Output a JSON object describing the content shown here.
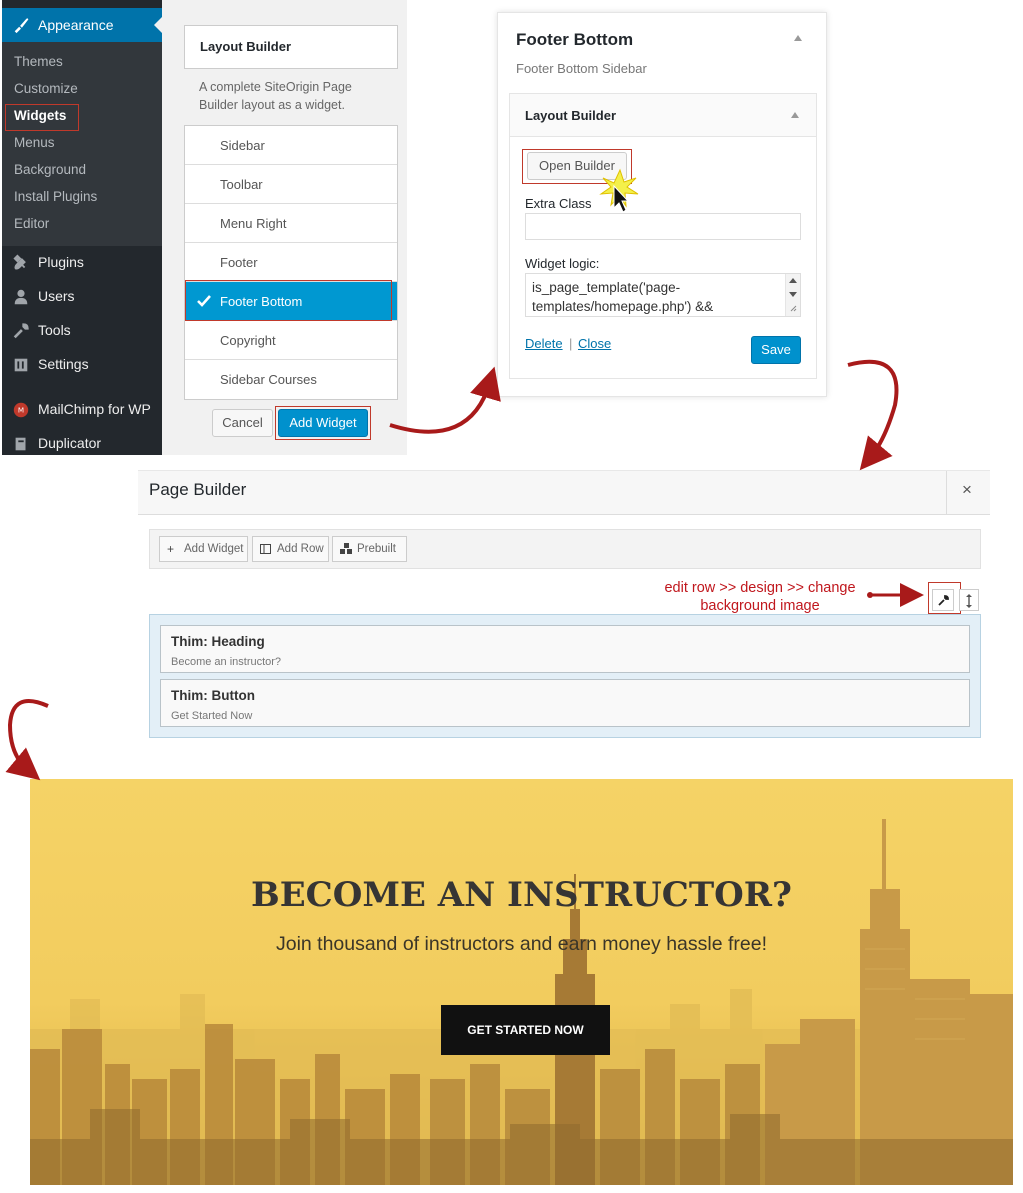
{
  "wp_menu": {
    "appearance": "Appearance",
    "submenu": [
      "Themes",
      "Customize",
      "Widgets",
      "Menus",
      "Background",
      "Install Plugins",
      "Editor"
    ],
    "current_submenu": "Widgets",
    "items": [
      {
        "label": "Plugins",
        "icon": "plugin-icon"
      },
      {
        "label": "Users",
        "icon": "users-icon"
      },
      {
        "label": "Tools",
        "icon": "wrench-icon"
      },
      {
        "label": "Settings",
        "icon": "settings-icon"
      },
      {
        "label": "MailChimp for WP",
        "icon": "mailchimp-icon"
      },
      {
        "label": "Duplicator",
        "icon": "duplicator-icon"
      }
    ]
  },
  "widget_chooser": {
    "widget_name": "Layout Builder",
    "description": "A complete SiteOrigin Page Builder layout as a widget.",
    "sidebars": [
      "Sidebar",
      "Toolbar",
      "Menu Right",
      "Footer",
      "Footer Bottom",
      "Copyright",
      "Sidebar Courses"
    ],
    "selected_sidebar": "Footer Bottom",
    "cancel_label": "Cancel",
    "add_label": "Add Widget"
  },
  "sidebar_panel": {
    "title": "Footer Bottom",
    "subtitle": "Footer Bottom Sidebar",
    "widget": {
      "title": "Layout Builder",
      "open_builder_label": "Open Builder",
      "extra_class_label": "Extra Class",
      "extra_class_value": "",
      "widget_logic_label": "Widget logic:",
      "widget_logic_value": "is_page_template('page-templates/homepage.php') &&",
      "delete_label": "Delete",
      "separator": "|",
      "close_label": "Close",
      "save_label": "Save"
    }
  },
  "page_builder": {
    "title": "Page Builder",
    "close_symbol": "×",
    "toolbar": [
      {
        "label": "Add Widget",
        "icon": "plus-icon"
      },
      {
        "label": "Add Row",
        "icon": "columns-icon"
      },
      {
        "label": "Prebuilt",
        "icon": "prebuilt-icon"
      }
    ],
    "annotation_line1": "edit row >> design >> change",
    "annotation_line2": "background image",
    "widgets": [
      {
        "title": "Thim: Heading",
        "description": "Become an instructor?"
      },
      {
        "title": "Thim: Button",
        "description": "Get Started Now"
      }
    ]
  },
  "hero": {
    "title": "BECOME AN INSTRUCTOR?",
    "subtitle": "Join thousand of instructors and earn money hassle free!",
    "button": "GET STARTED NOW"
  },
  "colors": {
    "wp_sidebar": "#23282d",
    "wp_accent": "#0073aa",
    "selected_blue": "#0098d1",
    "annotation_red": "#c0171d",
    "hero_yellow": "#f3cb5a"
  }
}
